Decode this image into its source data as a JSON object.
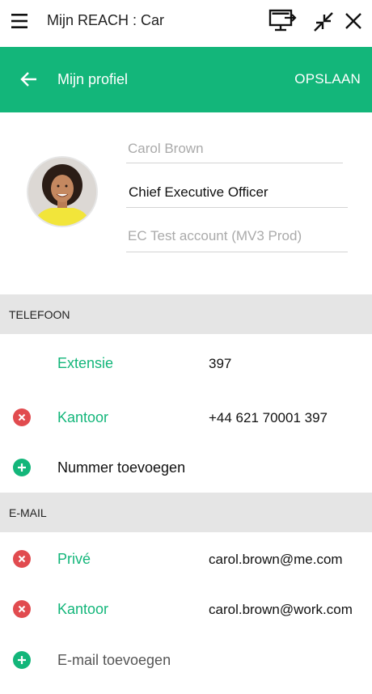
{
  "window": {
    "title": "Mijn REACH : Car"
  },
  "appbar": {
    "heading": "Mijn profiel",
    "save_label": "OPSLAAN"
  },
  "profile": {
    "name_placeholder": "Carol Brown",
    "job_title": "Chief Executive Officer",
    "company_placeholder": "EC Test account (MV3 Prod)"
  },
  "phone": {
    "section_title": "TELEFOON",
    "entries": [
      {
        "label": "Extensie",
        "value": "397",
        "removable": false
      },
      {
        "label": "Kantoor",
        "value": "+44 621 70001 397",
        "removable": true
      }
    ],
    "add_label": "Nummer toevoegen"
  },
  "email": {
    "section_title": "E-MAIL",
    "entries": [
      {
        "label": "Privé",
        "value": "carol.brown@me.com",
        "removable": true
      },
      {
        "label": "Kantoor",
        "value": "carol.brown@work.com",
        "removable": true
      }
    ],
    "add_label": "E-mail toevoegen"
  },
  "colors": {
    "accent": "#13b67a",
    "remove": "#e14b4f",
    "section_bg": "#e5e5e5"
  },
  "icons": {
    "menu": "hamburger-icon",
    "monitor": "monitor-arrow-icon",
    "compress": "compress-icon",
    "close": "close-icon",
    "back": "arrow-left-icon",
    "remove": "remove-circle-icon",
    "add": "add-circle-icon"
  }
}
